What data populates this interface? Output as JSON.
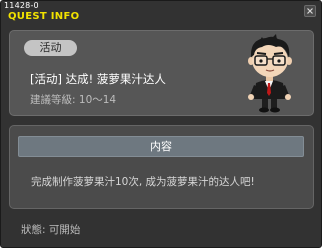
{
  "window": {
    "id_label": "11428-0",
    "title": "QUEST INFO"
  },
  "quest": {
    "category_tag": "活动",
    "name": "[活动] 达成! 菠萝果汁达人",
    "recommend_label": "建議等級:",
    "recommend_value": "10～14"
  },
  "content": {
    "header": "内容",
    "text": "完成制作菠萝果汁10次, 成为菠萝果汁的达人吧!"
  },
  "status": {
    "label": "狀態:",
    "value": "可開始"
  },
  "colors": {
    "title_yellow": "#f2e200",
    "window_bg": "#323232",
    "panel_bg": "#565656",
    "header_bar": "#6e7880"
  },
  "icons": {
    "close": "close-icon",
    "npc": "npc-portrait"
  }
}
